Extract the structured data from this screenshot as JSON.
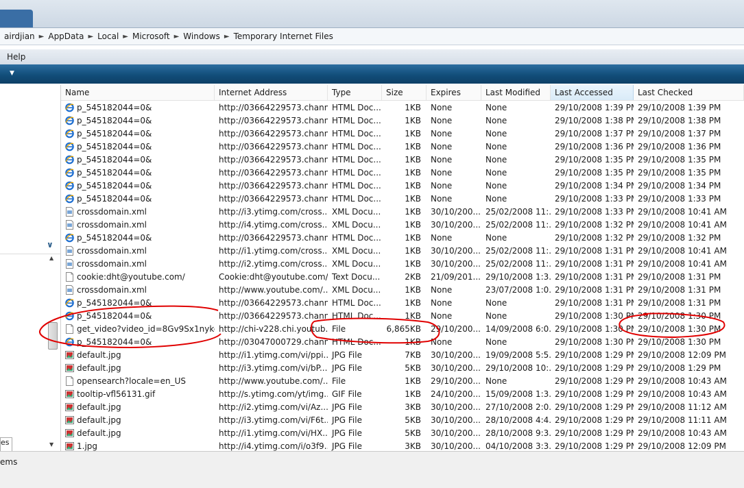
{
  "breadcrumb": [
    "airdjian",
    "AppData",
    "Local",
    "Microsoft",
    "Windows",
    "Temporary Internet Files"
  ],
  "menu": {
    "help": "Help"
  },
  "status": {
    "items_text": "ems",
    "tab_text": "es"
  },
  "annotation_color": "#e00000",
  "columns": [
    "Name",
    "Internet Address",
    "Type",
    "Size",
    "Expires",
    "Last Modified",
    "Last Accessed",
    "Last Checked"
  ],
  "rows": [
    {
      "icon": "ie",
      "name": "p_545182044=0&",
      "addr": "http://03664229573.chann...",
      "type": "HTML Doc...",
      "size": "1KB",
      "expires": "None",
      "modified": "None",
      "accessed": "29/10/2008 1:39 PM",
      "checked": "29/10/2008 1:39 PM"
    },
    {
      "icon": "ie",
      "name": "p_545182044=0&",
      "addr": "http://03664229573.chann...",
      "type": "HTML Doc...",
      "size": "1KB",
      "expires": "None",
      "modified": "None",
      "accessed": "29/10/2008 1:38 PM",
      "checked": "29/10/2008 1:38 PM"
    },
    {
      "icon": "ie",
      "name": "p_545182044=0&",
      "addr": "http://03664229573.chann...",
      "type": "HTML Doc...",
      "size": "1KB",
      "expires": "None",
      "modified": "None",
      "accessed": "29/10/2008 1:37 PM",
      "checked": "29/10/2008 1:37 PM"
    },
    {
      "icon": "ie",
      "name": "p_545182044=0&",
      "addr": "http://03664229573.chann...",
      "type": "HTML Doc...",
      "size": "1KB",
      "expires": "None",
      "modified": "None",
      "accessed": "29/10/2008 1:36 PM",
      "checked": "29/10/2008 1:36 PM"
    },
    {
      "icon": "ie",
      "name": "p_545182044=0&",
      "addr": "http://03664229573.chann...",
      "type": "HTML Doc...",
      "size": "1KB",
      "expires": "None",
      "modified": "None",
      "accessed": "29/10/2008 1:35 PM",
      "checked": "29/10/2008 1:35 PM"
    },
    {
      "icon": "ie",
      "name": "p_545182044=0&",
      "addr": "http://03664229573.chann...",
      "type": "HTML Doc...",
      "size": "1KB",
      "expires": "None",
      "modified": "None",
      "accessed": "29/10/2008 1:35 PM",
      "checked": "29/10/2008 1:35 PM"
    },
    {
      "icon": "ie",
      "name": "p_545182044=0&",
      "addr": "http://03664229573.chann...",
      "type": "HTML Doc...",
      "size": "1KB",
      "expires": "None",
      "modified": "None",
      "accessed": "29/10/2008 1:34 PM",
      "checked": "29/10/2008 1:34 PM"
    },
    {
      "icon": "ie",
      "name": "p_545182044=0&",
      "addr": "http://03664229573.chann...",
      "type": "HTML Doc...",
      "size": "1KB",
      "expires": "None",
      "modified": "None",
      "accessed": "29/10/2008 1:33 PM",
      "checked": "29/10/2008 1:33 PM"
    },
    {
      "icon": "xml",
      "name": "crossdomain.xml",
      "addr": "http://i3.ytimg.com/cross...",
      "type": "XML Docu...",
      "size": "1KB",
      "expires": "30/10/200...",
      "modified": "25/02/2008 11:...",
      "accessed": "29/10/2008 1:33 PM",
      "checked": "29/10/2008 10:41 AM"
    },
    {
      "icon": "xml",
      "name": "crossdomain.xml",
      "addr": "http://i4.ytimg.com/cross...",
      "type": "XML Docu...",
      "size": "1KB",
      "expires": "30/10/200...",
      "modified": "25/02/2008 11:...",
      "accessed": "29/10/2008 1:32 PM",
      "checked": "29/10/2008 10:41 AM"
    },
    {
      "icon": "ie",
      "name": "p_545182044=0&",
      "addr": "http://03664229573.chann...",
      "type": "HTML Doc...",
      "size": "1KB",
      "expires": "None",
      "modified": "None",
      "accessed": "29/10/2008 1:32 PM",
      "checked": "29/10/2008 1:32 PM"
    },
    {
      "icon": "xml",
      "name": "crossdomain.xml",
      "addr": "http://i1.ytimg.com/cross...",
      "type": "XML Docu...",
      "size": "1KB",
      "expires": "30/10/200...",
      "modified": "25/02/2008 11:...",
      "accessed": "29/10/2008 1:31 PM",
      "checked": "29/10/2008 10:41 AM"
    },
    {
      "icon": "xml",
      "name": "crossdomain.xml",
      "addr": "http://i2.ytimg.com/cross...",
      "type": "XML Docu...",
      "size": "1KB",
      "expires": "30/10/200...",
      "modified": "25/02/2008 11:...",
      "accessed": "29/10/2008 1:31 PM",
      "checked": "29/10/2008 10:41 AM"
    },
    {
      "icon": "file",
      "name": "cookie:dht@youtube.com/",
      "addr": "Cookie:dht@youtube.com/",
      "type": "Text Docu...",
      "size": "2KB",
      "expires": "21/09/201...",
      "modified": "29/10/2008 1:3...",
      "accessed": "29/10/2008 1:31 PM",
      "checked": "29/10/2008 1:31 PM"
    },
    {
      "icon": "xml",
      "name": "crossdomain.xml",
      "addr": "http://www.youtube.com/...",
      "type": "XML Docu...",
      "size": "1KB",
      "expires": "None",
      "modified": "23/07/2008 1:0...",
      "accessed": "29/10/2008 1:31 PM",
      "checked": "29/10/2008 1:31 PM"
    },
    {
      "icon": "ie",
      "name": "p_545182044=0&",
      "addr": "http://03664229573.chann...",
      "type": "HTML Doc...",
      "size": "1KB",
      "expires": "None",
      "modified": "None",
      "accessed": "29/10/2008 1:31 PM",
      "checked": "29/10/2008 1:31 PM"
    },
    {
      "icon": "ie",
      "name": "p_545182044=0&",
      "addr": "http://03664229573.chann...",
      "type": "HTML Doc...",
      "size": "1KB",
      "expires": "None",
      "modified": "None",
      "accessed": "29/10/2008 1:30 PM",
      "checked": "29/10/2008 1:30 PM"
    },
    {
      "icon": "file",
      "name": "get_video?video_id=8Gv9Sx1nyko...",
      "addr": "http://chi-v228.chi.youtub...",
      "type": "File",
      "size": "6,865KB",
      "expires": "29/10/200...",
      "modified": "14/09/2008 6:0...",
      "accessed": "29/10/2008 1:30 PM",
      "checked": "29/10/2008 1:30 PM"
    },
    {
      "icon": "ie",
      "name": "p_545182044=0&",
      "addr": "http://03047000729.chann...",
      "type": "HTML Doc...",
      "size": "1KB",
      "expires": "None",
      "modified": "None",
      "accessed": "29/10/2008 1:30 PM",
      "checked": "29/10/2008 1:30 PM"
    },
    {
      "icon": "jpg",
      "name": "default.jpg",
      "addr": "http://i1.ytimg.com/vi/ppi...",
      "type": "JPG File",
      "size": "7KB",
      "expires": "30/10/200...",
      "modified": "19/09/2008 5:5...",
      "accessed": "29/10/2008 1:29 PM",
      "checked": "29/10/2008 12:09 PM"
    },
    {
      "icon": "jpg",
      "name": "default.jpg",
      "addr": "http://i3.ytimg.com/vi/bP...",
      "type": "JPG File",
      "size": "5KB",
      "expires": "30/10/200...",
      "modified": "29/10/2008 10:...",
      "accessed": "29/10/2008 1:29 PM",
      "checked": "29/10/2008 1:29 PM"
    },
    {
      "icon": "file",
      "name": "opensearch?locale=en_US",
      "addr": "http://www.youtube.com/...",
      "type": "File",
      "size": "1KB",
      "expires": "29/10/200...",
      "modified": "None",
      "accessed": "29/10/2008 1:29 PM",
      "checked": "29/10/2008 10:43 AM"
    },
    {
      "icon": "jpg",
      "name": "tooltip-vfl56131.gif",
      "addr": "http://s.ytimg.com/yt/img...",
      "type": "GIF File",
      "size": "1KB",
      "expires": "24/10/200...",
      "modified": "15/09/2008 1:3...",
      "accessed": "29/10/2008 1:29 PM",
      "checked": "29/10/2008 10:43 AM"
    },
    {
      "icon": "jpg",
      "name": "default.jpg",
      "addr": "http://i2.ytimg.com/vi/Az...",
      "type": "JPG File",
      "size": "3KB",
      "expires": "30/10/200...",
      "modified": "27/10/2008 2:0...",
      "accessed": "29/10/2008 1:29 PM",
      "checked": "29/10/2008 11:12 AM"
    },
    {
      "icon": "jpg",
      "name": "default.jpg",
      "addr": "http://i3.ytimg.com/vi/F6t...",
      "type": "JPG File",
      "size": "5KB",
      "expires": "30/10/200...",
      "modified": "28/10/2008 4:4...",
      "accessed": "29/10/2008 1:29 PM",
      "checked": "29/10/2008 11:11 AM"
    },
    {
      "icon": "jpg",
      "name": "default.jpg",
      "addr": "http://i1.ytimg.com/vi/HX...",
      "type": "JPG File",
      "size": "5KB",
      "expires": "30/10/200...",
      "modified": "28/10/2008 9:3...",
      "accessed": "29/10/2008 1:29 PM",
      "checked": "29/10/2008 10:43 AM"
    },
    {
      "icon": "jpg",
      "name": "1.jpg",
      "addr": "http://i4.ytimg.com/i/o3f9...",
      "type": "JPG File",
      "size": "3KB",
      "expires": "30/10/200...",
      "modified": "04/10/2008 3:3...",
      "accessed": "29/10/2008 1:29 PM",
      "checked": "29/10/2008 12:09 PM"
    }
  ]
}
